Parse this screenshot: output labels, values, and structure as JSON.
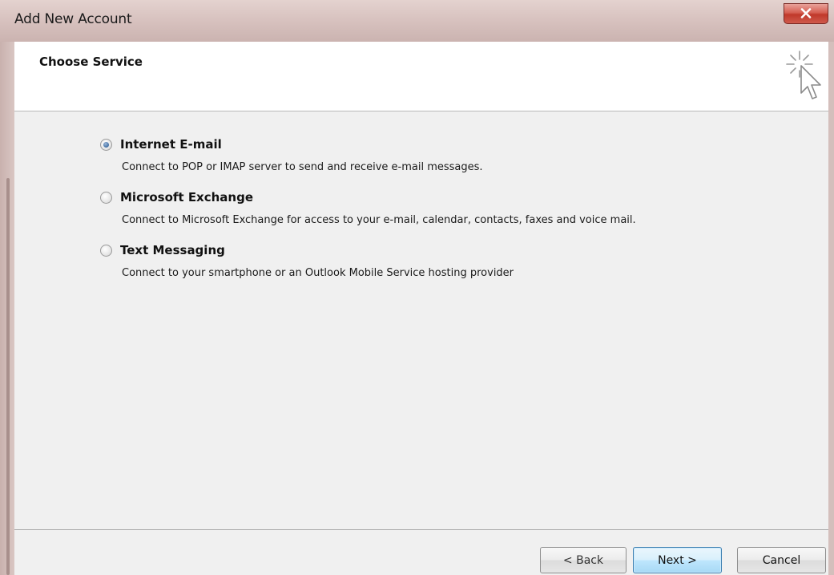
{
  "window": {
    "title": "Add New Account"
  },
  "header": {
    "title": "Choose Service"
  },
  "options": [
    {
      "label": "Internet E-mail",
      "description": "Connect to POP or IMAP server to send and receive e-mail messages.",
      "selected": true
    },
    {
      "label": "Microsoft Exchange",
      "description": "Connect to Microsoft Exchange for access to your e-mail, calendar, contacts, faxes and voice mail.",
      "selected": false
    },
    {
      "label": "Text Messaging",
      "description": "Connect to your smartphone or an Outlook Mobile Service hosting provider",
      "selected": false
    }
  ],
  "buttons": {
    "back": "< Back",
    "next": "Next >",
    "cancel": "Cancel"
  },
  "colors": {
    "close_button": "#c0392b",
    "default_button_border": "#3c7fb1",
    "content_background": "#f0f0f0"
  },
  "icons": {
    "close": "close-icon",
    "wizard": "cursor-sparkle-icon"
  }
}
